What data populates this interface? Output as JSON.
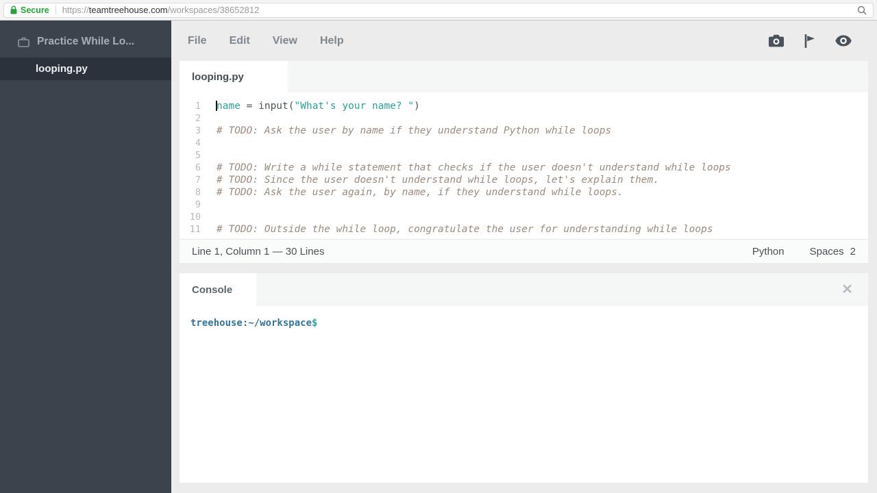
{
  "browser": {
    "secure_label": "Secure",
    "url": {
      "scheme": "https://",
      "domain": "teamtreehouse.com",
      "path": "/workspaces/38652812"
    }
  },
  "sidebar": {
    "project_name": "Practice While Lo...",
    "files": [
      {
        "name": "looping.py",
        "selected": true
      }
    ]
  },
  "menubar": {
    "items": [
      "File",
      "Edit",
      "View",
      "Help"
    ],
    "icons": [
      "camera-icon",
      "pointer-flag-icon",
      "eye-icon"
    ]
  },
  "editor": {
    "tab_label": "looping.py",
    "cursor": {
      "line": 1,
      "column": 1
    },
    "lines": [
      {
        "n": 1,
        "segments": [
          {
            "t": "name",
            "c": "ident"
          },
          {
            "t": " = input(",
            "c": "plain"
          },
          {
            "t": "\"What's your name? \"",
            "c": "string"
          },
          {
            "t": ")",
            "c": "plain"
          }
        ]
      },
      {
        "n": 2,
        "segments": []
      },
      {
        "n": 3,
        "segments": [
          {
            "t": "# TODO: Ask the user by name if they understand Python while loops",
            "c": "comment"
          }
        ]
      },
      {
        "n": 4,
        "segments": []
      },
      {
        "n": 5,
        "segments": []
      },
      {
        "n": 6,
        "segments": [
          {
            "t": "# TODO: Write a while statement that checks if the user doesn't understand while loops",
            "c": "comment"
          }
        ]
      },
      {
        "n": 7,
        "segments": [
          {
            "t": "# TODO: Since the user doesn't understand while loops, let's explain them.",
            "c": "comment"
          }
        ]
      },
      {
        "n": 8,
        "segments": [
          {
            "t": "# TODO: Ask the user again, by name, if they understand while loops.",
            "c": "comment"
          }
        ]
      },
      {
        "n": 9,
        "segments": []
      },
      {
        "n": 10,
        "segments": []
      },
      {
        "n": 11,
        "segments": [
          {
            "t": "# TODO: Outside the while loop, congratulate the user for understanding while loops",
            "c": "comment"
          }
        ]
      }
    ],
    "status_bar": {
      "position": "Line 1, Column 1 — 30 Lines",
      "language": "Python",
      "indent_type": "Spaces",
      "indent_size": "2"
    }
  },
  "console": {
    "tab_label": "Console",
    "close_glyph": "✕",
    "prompt": "treehouse:~/workspace",
    "prompt_symbol": "$"
  },
  "colors": {
    "secure_green": "#23a335",
    "sidebar_bg": "#3b434d",
    "sidebar_selected": "#2b323b",
    "syntax_teal": "#2aa198",
    "comment_brown": "#9d8b80",
    "prompt_blue": "#36739d",
    "icon_gray": "#4a535b"
  }
}
